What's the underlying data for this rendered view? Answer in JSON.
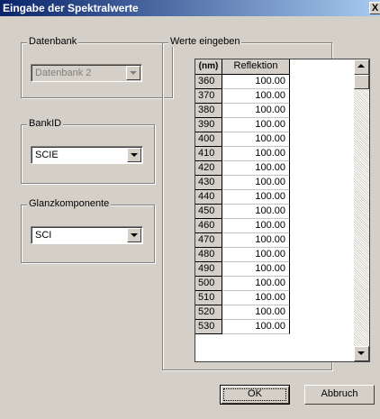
{
  "window": {
    "title": "Eingabe der Spektralwerte",
    "close_label": "X"
  },
  "datenbank": {
    "legend": "Datenbank",
    "value": "Datenbank 2",
    "disabled": true
  },
  "bankid": {
    "legend": "BankID",
    "value": "SCIE"
  },
  "glanz": {
    "legend": "Glanzkomponente",
    "value": "SCI"
  },
  "werte": {
    "legend": "Werte eingeben",
    "columns": {
      "nm": "(nm)",
      "refl": "Reflektion"
    },
    "rows": [
      {
        "nm": "360",
        "value": "100.00"
      },
      {
        "nm": "370",
        "value": "100.00"
      },
      {
        "nm": "380",
        "value": "100.00"
      },
      {
        "nm": "390",
        "value": "100.00"
      },
      {
        "nm": "400",
        "value": "100.00"
      },
      {
        "nm": "410",
        "value": "100.00"
      },
      {
        "nm": "420",
        "value": "100.00"
      },
      {
        "nm": "430",
        "value": "100.00"
      },
      {
        "nm": "440",
        "value": "100.00"
      },
      {
        "nm": "450",
        "value": "100.00"
      },
      {
        "nm": "460",
        "value": "100.00"
      },
      {
        "nm": "470",
        "value": "100.00"
      },
      {
        "nm": "480",
        "value": "100.00"
      },
      {
        "nm": "490",
        "value": "100.00"
      },
      {
        "nm": "500",
        "value": "100.00"
      },
      {
        "nm": "510",
        "value": "100.00"
      },
      {
        "nm": "520",
        "value": "100.00"
      },
      {
        "nm": "530",
        "value": "100.00"
      }
    ]
  },
  "buttons": {
    "ok": "OK",
    "cancel": "Abbruch"
  }
}
